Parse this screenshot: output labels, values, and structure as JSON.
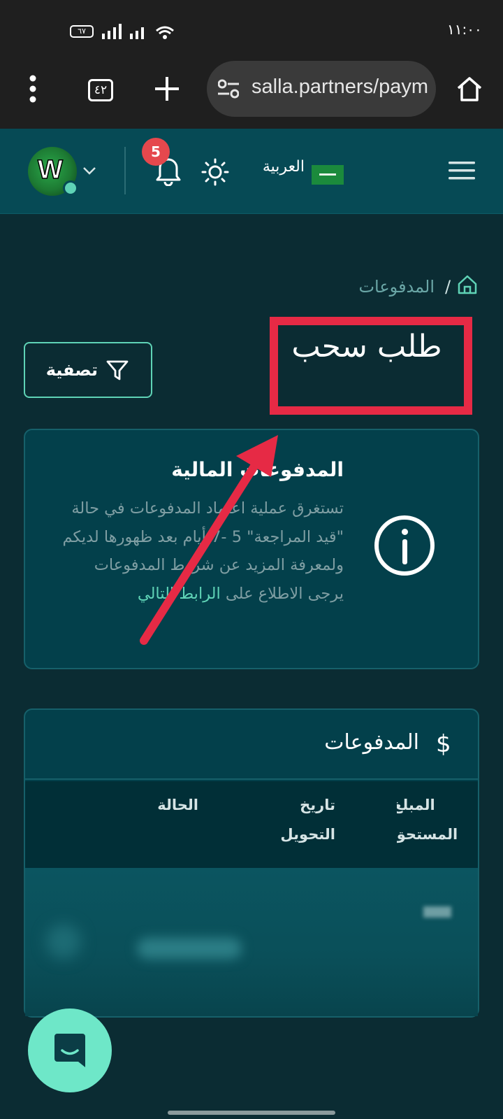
{
  "status_bar": {
    "time": "١١:٠٠",
    "battery": "٦٧"
  },
  "browser": {
    "url": "salla.partners/payments",
    "tab_count": "٤٢"
  },
  "header": {
    "language": "العربية",
    "notification_count": "5",
    "avatar_letter": "W"
  },
  "breadcrumb": {
    "current": "المدفوعات"
  },
  "page": {
    "title": "طلب سحب",
    "filter_label": "تصفية"
  },
  "info_card": {
    "title": "المدفوعات المالية",
    "body": "تستغرق عملية اعتماد المدفوعات في حالة \"قيد المراجعة\" 5 -7 أيام بعد ظهورها لديكم ولمعرفة المزيد عن شروط المدفوعات يرجى الاطلاع على",
    "link": "الرابط التالي"
  },
  "payments_card": {
    "title": "المدفوعات",
    "columns": [
      "المبلغ المستحق",
      "تاريخ التحويل",
      "الحالة"
    ],
    "column_lines": {
      "amount_1": "المبلغ",
      "amount_2": "المستحق",
      "date_1": "تاريخ",
      "date_2": "التحويل",
      "status": "الحالة"
    }
  },
  "colors": {
    "accent": "#5fd3b6",
    "annotation": "#e62a45",
    "background": "#0b2c33"
  }
}
